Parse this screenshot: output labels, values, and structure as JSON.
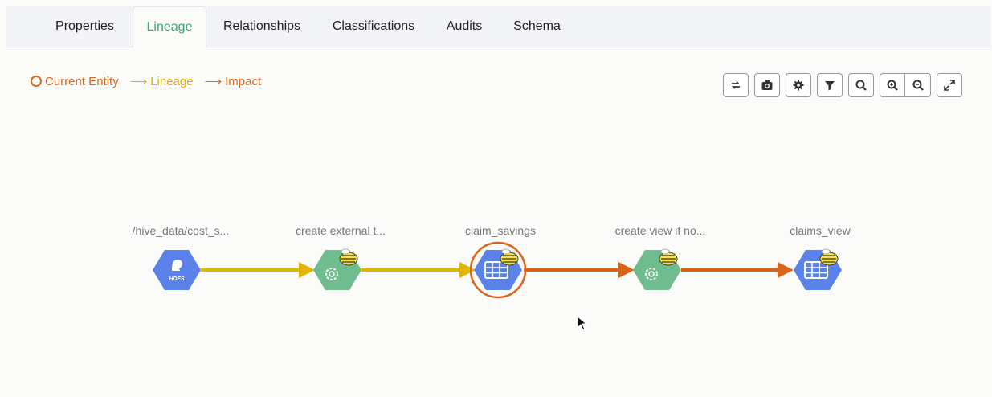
{
  "tabs": [
    {
      "label": "Properties",
      "active": false
    },
    {
      "label": "Lineage",
      "active": true
    },
    {
      "label": "Relationships",
      "active": false
    },
    {
      "label": "Classifications",
      "active": false
    },
    {
      "label": "Audits",
      "active": false
    },
    {
      "label": "Schema",
      "active": false
    }
  ],
  "legend": {
    "current": "Current Entity",
    "lineage": "Lineage",
    "impact": "Impact"
  },
  "toolbar_icons": [
    "refresh-icon",
    "camera-icon",
    "settings-icon",
    "filter-icon",
    "search-icon",
    "zoom-in-icon",
    "zoom-out-icon",
    "fullscreen-icon"
  ],
  "nodes": [
    {
      "label": "/hive_data/cost_s...",
      "type": "hdfs",
      "badge": "HDFS"
    },
    {
      "label": "create external t...",
      "type": "process"
    },
    {
      "label": "claim_savings",
      "type": "table",
      "current": true
    },
    {
      "label": "create view if no...",
      "type": "process"
    },
    {
      "label": "claims_view",
      "type": "table"
    }
  ],
  "colors": {
    "lineage": "#e3b500",
    "impact": "#d9641a",
    "active_tab": "#3aa37a",
    "blue_node": "#5b82e8",
    "green_node": "#6fbd8f"
  }
}
